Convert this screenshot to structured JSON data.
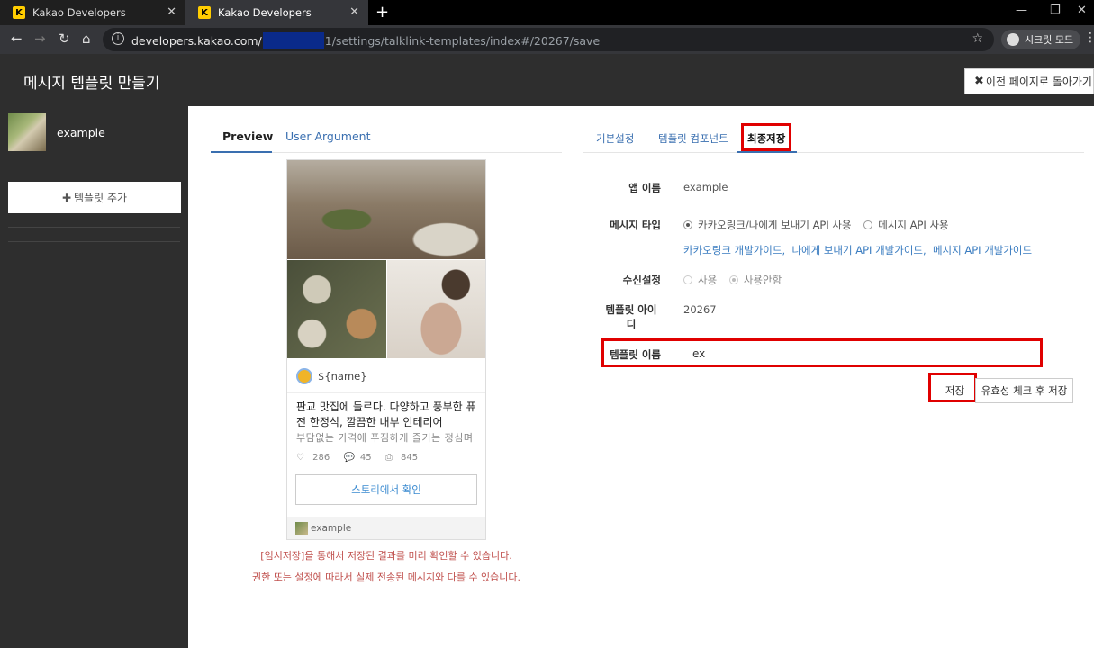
{
  "browser": {
    "tabs": [
      {
        "title": "Kakao Developers",
        "favicon": "K"
      },
      {
        "title": "Kakao Developers",
        "favicon": "K"
      }
    ],
    "url_host": "developers.kakao.com/",
    "url_path": "1/settings/talklink-templates/index#/20267/save",
    "incognito_label": "시크릿 모드"
  },
  "header": {
    "title": "메시지 템플릿 만들기",
    "back_label": "이전 페이지로 돌아가기"
  },
  "sidebar": {
    "app_name": "example",
    "add_template_label": "템플릿 추가"
  },
  "preview": {
    "tabs": [
      "Preview",
      "User Argument"
    ],
    "profile_name": "${name}",
    "title": "판교 맛집에 들르다. 다양하고 풍부한 퓨전 한정식, 깔끔한 내부 인테리어",
    "description": "부담없는 가격에 푸짐하게 즐기는 정심며",
    "likes": "286",
    "comments": "45",
    "shares": "845",
    "button_label": "스토리에서 확인",
    "footer_name": "example",
    "notice_1": "[임시저장]을 통해서 저장된 결과를 미리 확인할 수 있습니다.",
    "notice_2": "권한 또는 설정에 따라서 실제 전송된 메시지와 다를 수 있습니다."
  },
  "settings": {
    "tabs": [
      "기본설정",
      "템플릿 컴포넌트",
      "최종저장"
    ],
    "app_name_label": "앱 이름",
    "app_name_value": "example",
    "msg_type_label": "메시지 타입",
    "msg_type_options": [
      "카카오링크/나에게 보내기 API 사용",
      "메시지 API 사용"
    ],
    "guide_links": [
      "카카오링크 개발가이드",
      "나에게 보내기 API 개발가이드",
      "메시지 API 개발가이드"
    ],
    "receive_label": "수신설정",
    "receive_options": [
      "사용",
      "사용안함"
    ],
    "template_id_label": "템플릿 아이디",
    "template_id_value": "20267",
    "template_name_label": "템플릿 이름",
    "template_name_value": "ex",
    "save_label": "저장",
    "check_save_label": "유효성 체크 후 저장"
  },
  "colors": {
    "highlight": "#e00000",
    "link": "#3a6fb0",
    "notice": "#c0504d",
    "dark_bg": "#2e2e2e"
  }
}
